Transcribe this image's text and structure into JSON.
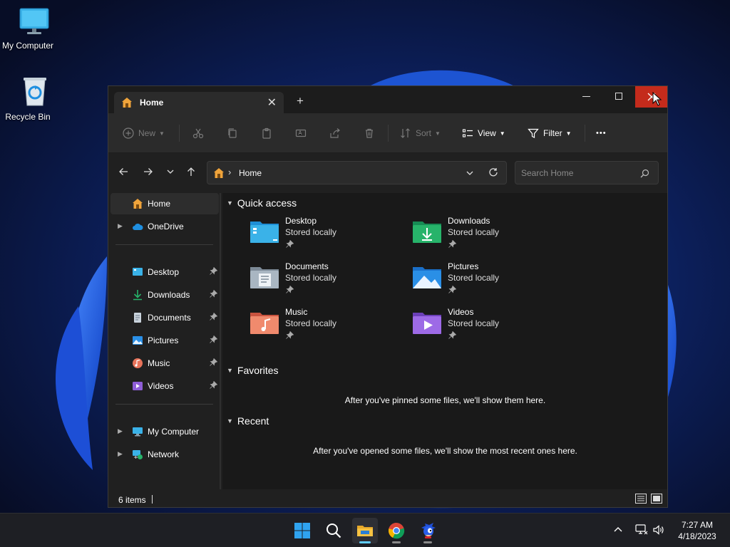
{
  "desktop": {
    "icons": [
      {
        "label": "My Computer",
        "icon": "monitor-icon"
      },
      {
        "label": "Recycle Bin",
        "icon": "recycle-bin-icon"
      }
    ]
  },
  "window": {
    "tab_title": "Home",
    "tab_close": "✕",
    "new_tab": "+",
    "controls": {
      "minimize": "minimize",
      "maximize": "maximize",
      "close": "close"
    }
  },
  "toolbar": {
    "new_label": "New",
    "sort_label": "Sort",
    "view_label": "View",
    "filter_label": "Filter",
    "more_label": "•••"
  },
  "navigation": {
    "address_label": "Home",
    "search_placeholder": "Search Home"
  },
  "sidebar": {
    "items": [
      {
        "label": "Home",
        "icon": "home-icon",
        "selected": true
      },
      {
        "label": "OneDrive",
        "icon": "cloud-icon",
        "expandable": true
      },
      {
        "label": "Desktop",
        "icon": "desktop-folder-icon",
        "pinned": true
      },
      {
        "label": "Downloads",
        "icon": "download-icon",
        "pinned": true
      },
      {
        "label": "Documents",
        "icon": "document-icon",
        "pinned": true
      },
      {
        "label": "Pictures",
        "icon": "pictures-icon",
        "pinned": true
      },
      {
        "label": "Music",
        "icon": "music-icon",
        "pinned": true
      },
      {
        "label": "Videos",
        "icon": "videos-icon",
        "pinned": true
      },
      {
        "label": "My Computer",
        "icon": "monitor-icon",
        "expandable": true
      },
      {
        "label": "Network",
        "icon": "network-icon",
        "expandable": true
      }
    ]
  },
  "content": {
    "quick_access": {
      "title": "Quick access",
      "items": [
        {
          "name": "Desktop",
          "status": "Stored locally",
          "icon": "desktop-folder-icon"
        },
        {
          "name": "Downloads",
          "status": "Stored locally",
          "icon": "downloads-folder-icon"
        },
        {
          "name": "Documents",
          "status": "Stored locally",
          "icon": "documents-folder-icon"
        },
        {
          "name": "Pictures",
          "status": "Stored locally",
          "icon": "pictures-folder-icon"
        },
        {
          "name": "Music",
          "status": "Stored locally",
          "icon": "music-folder-icon"
        },
        {
          "name": "Videos",
          "status": "Stored locally",
          "icon": "videos-folder-icon"
        }
      ]
    },
    "favorites": {
      "title": "Favorites",
      "empty_message": "After you've pinned some files, we'll show them here."
    },
    "recent": {
      "title": "Recent",
      "empty_message": "After you've opened some files, we'll show the most recent ones here."
    }
  },
  "statusbar": {
    "item_count": "6 items"
  },
  "taskbar": {
    "apps": [
      {
        "name": "start",
        "icon": "windows-start-icon"
      },
      {
        "name": "search",
        "icon": "search-icon"
      },
      {
        "name": "file-explorer",
        "icon": "file-explorer-icon",
        "active": true
      },
      {
        "name": "chrome",
        "icon": "chrome-icon"
      },
      {
        "name": "sonic",
        "icon": "sonic-app-icon"
      }
    ],
    "clock": {
      "time": "7:27 AM",
      "date": "4/18/2023"
    }
  },
  "colors": {
    "accent": "#60cdff",
    "close_red": "#c42b1c",
    "folder_yellow": "#f5c243"
  }
}
